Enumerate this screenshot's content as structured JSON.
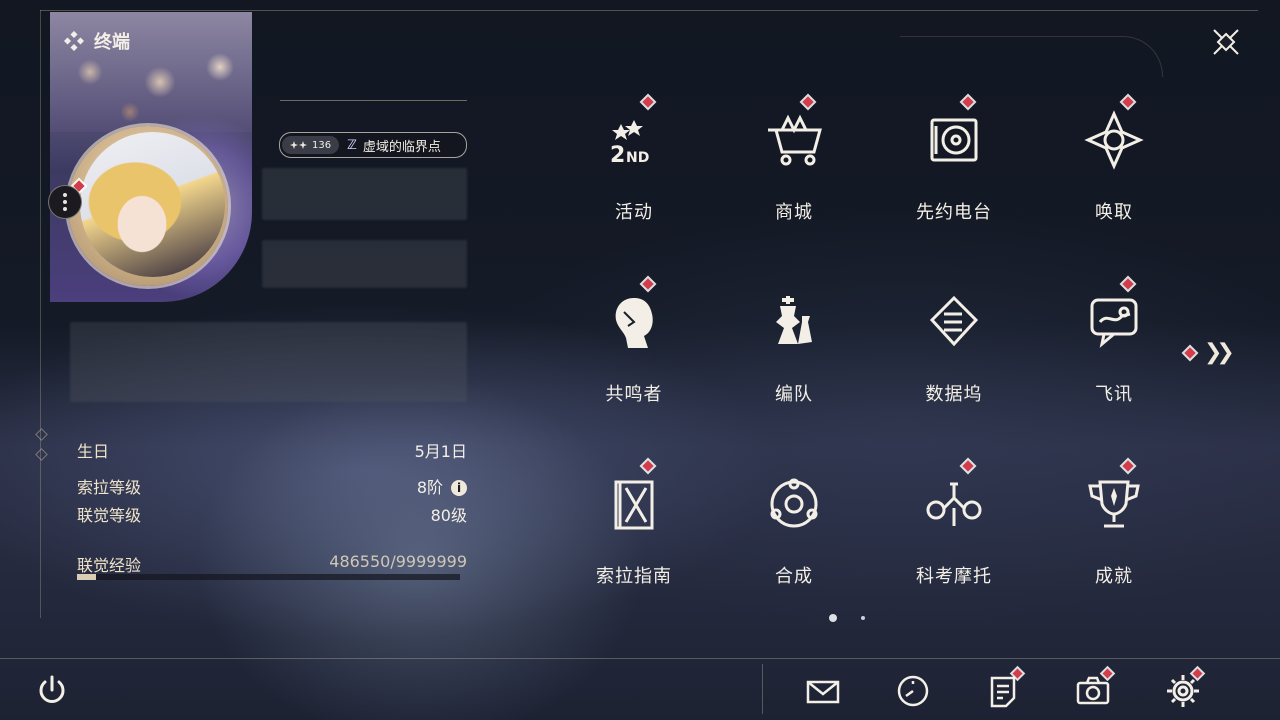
{
  "terminal": {
    "title": "终端",
    "icon": "diamond-cluster-icon"
  },
  "profile": {
    "union_badge_level": "136",
    "tag_text": "虚域的临界点",
    "stats": [
      {
        "label": "生日",
        "value": "5月1日"
      },
      {
        "label": "索拉等级",
        "value": "8阶"
      },
      {
        "label": "联觉等级",
        "value": "80级"
      }
    ],
    "exp_label": "联觉经验",
    "exp_value": "486550/9999999",
    "exp_progress": 0.0487
  },
  "menu": [
    {
      "label": "活动",
      "icon": "event-2nd-anniversary-icon",
      "badge": true
    },
    {
      "label": "商城",
      "icon": "shop-cart-crown-icon",
      "badge": true
    },
    {
      "label": "先约电台",
      "icon": "radio-vinyl-icon",
      "badge": true
    },
    {
      "label": "唤取",
      "icon": "convene-star-icon",
      "badge": true
    },
    {
      "label": "共鸣者",
      "icon": "resonator-portrait-icon",
      "badge": true
    },
    {
      "label": "编队",
      "icon": "team-chess-icon",
      "badge": false
    },
    {
      "label": "数据坞",
      "icon": "data-bank-icon",
      "badge": false
    },
    {
      "label": "飞讯",
      "icon": "message-chat-icon",
      "badge": true
    },
    {
      "label": "索拉指南",
      "icon": "guidebook-icon",
      "badge": true
    },
    {
      "label": "合成",
      "icon": "synthesis-icon",
      "badge": false
    },
    {
      "label": "科考摩托",
      "icon": "motorcycle-icon",
      "badge": true
    },
    {
      "label": "成就",
      "icon": "trophy-icon",
      "badge": true
    }
  ],
  "pager": {
    "pages": 2,
    "current": 1
  },
  "bottom_bar": [
    {
      "name": "mail",
      "icon": "mail-icon",
      "badge": false
    },
    {
      "name": "events-clock",
      "icon": "clock-icon",
      "badge": false
    },
    {
      "name": "notes",
      "icon": "notes-icon",
      "badge": true
    },
    {
      "name": "camera",
      "icon": "camera-icon",
      "badge": true
    },
    {
      "name": "settings",
      "icon": "gear-icon",
      "badge": true
    }
  ],
  "colors": {
    "badge_red": "#d23c4b",
    "text_gold": "#efe3c9",
    "line": "#c8bea0"
  }
}
